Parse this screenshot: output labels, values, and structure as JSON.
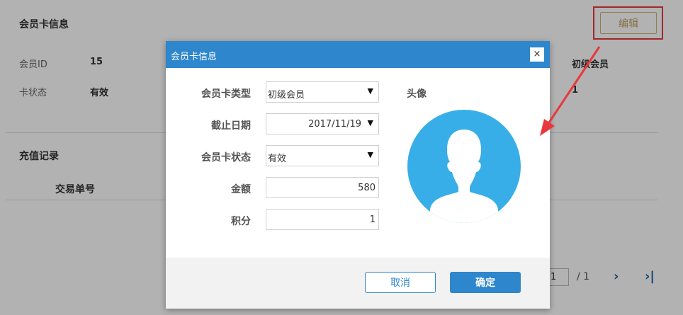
{
  "background": {
    "section_title": "会员卡信息",
    "edit_button": "编辑",
    "fields": [
      {
        "label": "会员ID",
        "value": "15"
      },
      {
        "label": "卡状态",
        "value": "有效"
      }
    ],
    "right_value_1": "初级会员",
    "right_value_2": "1",
    "recharge_title": "充值记录",
    "table_header_col1": "交易单号",
    "pager": {
      "current": "1",
      "total": "/ 1",
      "next_icon": "›",
      "last_icon": "›|"
    }
  },
  "modal": {
    "title": "会员卡信息",
    "close_icon": "×",
    "form": {
      "card_type_label": "会员卡类型",
      "card_type_value": "初级会员",
      "deadline_label": "截止日期",
      "deadline_value": "2017/11/19",
      "status_label": "会员卡状态",
      "status_value": "有效",
      "amount_label": "金额",
      "amount_value": "580",
      "points_label": "积分",
      "points_value": "1"
    },
    "avatar_label": "头像",
    "cancel_button": "取消",
    "ok_button": "确定"
  },
  "colors": {
    "header_blue": "#2e86cc",
    "avatar_blue": "#38aee8",
    "highlight_red": "#e8383d"
  }
}
